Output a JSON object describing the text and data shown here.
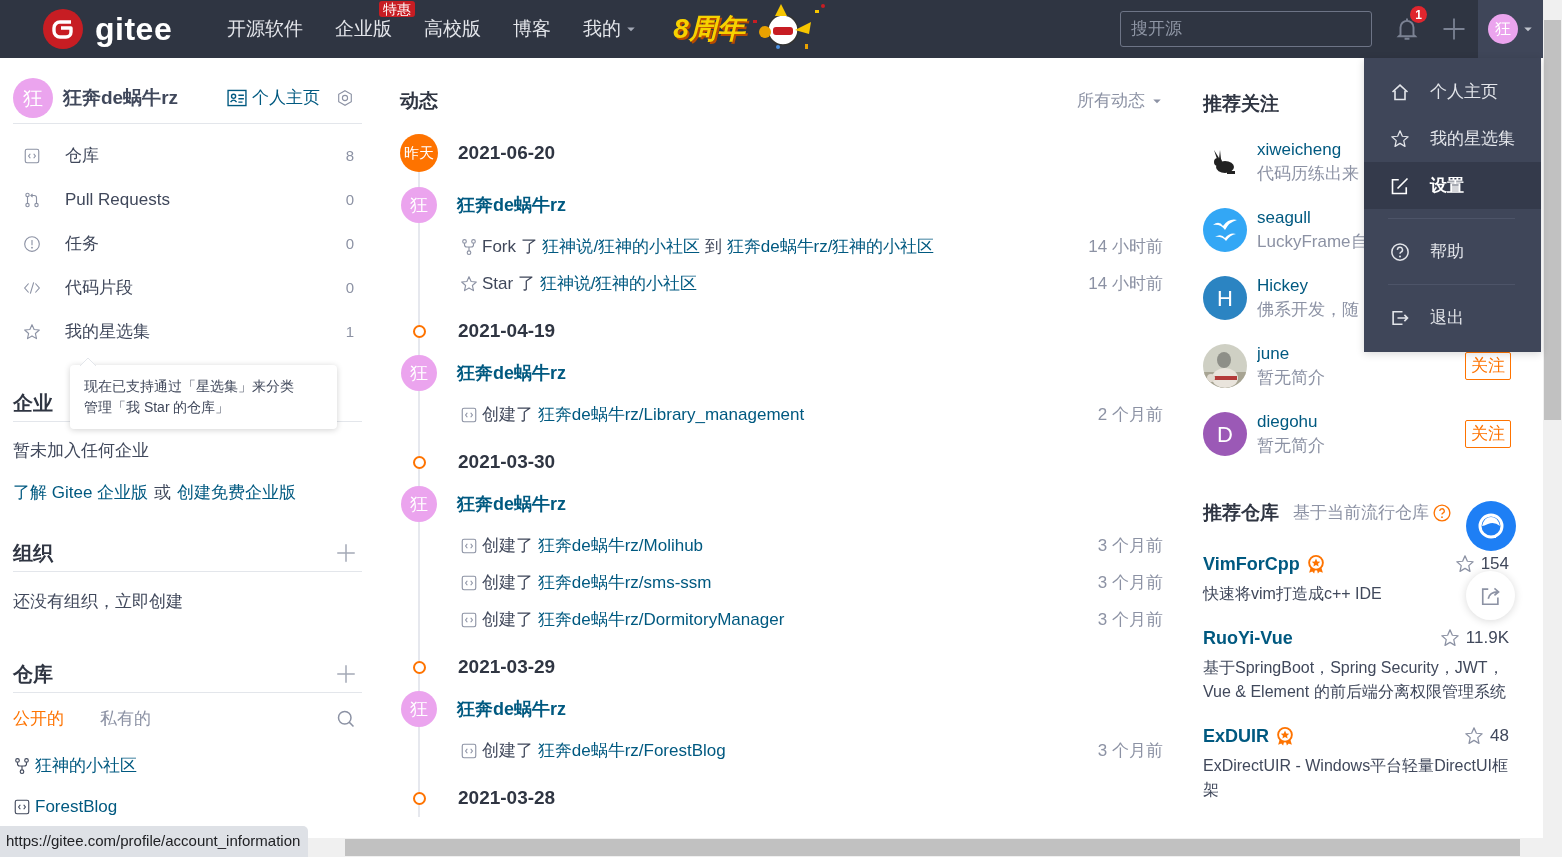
{
  "navbar": {
    "logo": "gitee",
    "links": [
      {
        "label": "开源软件"
      },
      {
        "label": "企业版",
        "badge": "特惠"
      },
      {
        "label": "高校版"
      },
      {
        "label": "博客"
      },
      {
        "label": "我的",
        "has_menu": true
      }
    ],
    "anniversary": "8周年",
    "search": {
      "placeholder": "搜开源"
    },
    "notification_count": "1",
    "avatar": "狂",
    "menu_open": true
  },
  "user_menu": [
    {
      "kind": "home",
      "label": "个人主页",
      "selected": false,
      "divider_before": false
    },
    {
      "kind": "star",
      "label": "我的星选集",
      "selected": false,
      "divider_before": false
    },
    {
      "kind": "edit",
      "label": "设置",
      "selected": true,
      "divider_before": false
    },
    {
      "kind": "help",
      "label": "帮助",
      "selected": false,
      "divider_before": true
    },
    {
      "kind": "logout",
      "label": "退出",
      "selected": false,
      "divider_before": true
    }
  ],
  "profile": {
    "avatar": "狂",
    "name": "狂奔de蜗牛rz",
    "homepage": "个人主页"
  },
  "sidebar": {
    "items": [
      {
        "kind": "repo",
        "label": "仓库",
        "count": "8"
      },
      {
        "kind": "pull",
        "label": "Pull Requests",
        "count": "0"
      },
      {
        "kind": "issue",
        "label": "任务",
        "count": "0"
      },
      {
        "kind": "code",
        "label": "代码片段",
        "count": "0"
      },
      {
        "kind": "star",
        "label": "我的星选集",
        "count": "1"
      }
    ]
  },
  "tooltip": "现在已支持通过「星选集」来分类管理「我 Star 的仓库」",
  "enterprise": {
    "title": "企业",
    "empty": "暂未加入任何企业",
    "parts": [
      {
        "text": "了解 Gitee 企业版",
        "link": true
      },
      {
        "text": "或",
        "link": false
      },
      {
        "text": "创建免费企业版",
        "link": true
      }
    ]
  },
  "organizations": {
    "title": "组织",
    "empty": "还没有组织，立即创建"
  },
  "repositories": {
    "title": "仓库",
    "tabs": [
      {
        "label": "公开的",
        "selected": true
      },
      {
        "label": "私有的",
        "selected": false
      }
    ],
    "items": [
      {
        "kind": "fork",
        "name": "狂神的小社区"
      },
      {
        "kind": "repo",
        "name": "ForestBlog"
      }
    ]
  },
  "feed": {
    "title": "动态",
    "filter": "所有动态",
    "groups": [
      {
        "date": "2021-06-20",
        "marker": "昨天",
        "user": {
          "avatar": "狂",
          "name": "狂奔de蜗牛rz"
        },
        "events": [
          {
            "kind": "fork",
            "parts": [
              {
                "text": "Fork 了",
                "link": false
              },
              {
                "text": "狂神说/狂神的小社区",
                "link": true
              },
              {
                "text": "到",
                "link": false
              },
              {
                "text": "狂奔de蜗牛rz/狂神的小社区",
                "link": true
              }
            ],
            "time": "14 小时前"
          },
          {
            "kind": "star",
            "parts": [
              {
                "text": "Star 了",
                "link": false
              },
              {
                "text": "狂神说/狂神的小社区",
                "link": true
              }
            ],
            "time": "14 小时前"
          }
        ]
      },
      {
        "date": "2021-04-19",
        "user": {
          "avatar": "狂",
          "name": "狂奔de蜗牛rz"
        },
        "events": [
          {
            "kind": "repo",
            "parts": [
              {
                "text": "创建了",
                "link": false
              },
              {
                "text": "狂奔de蜗牛rz/Library_management",
                "link": true
              }
            ],
            "time": "2 个月前"
          }
        ]
      },
      {
        "date": "2021-03-30",
        "user": {
          "avatar": "狂",
          "name": "狂奔de蜗牛rz"
        },
        "events": [
          {
            "kind": "repo",
            "parts": [
              {
                "text": "创建了",
                "link": false
              },
              {
                "text": "狂奔de蜗牛rz/Molihub",
                "link": true
              }
            ],
            "time": "3 个月前"
          },
          {
            "kind": "repo",
            "parts": [
              {
                "text": "创建了",
                "link": false
              },
              {
                "text": "狂奔de蜗牛rz/sms-ssm",
                "link": true
              }
            ],
            "time": "3 个月前"
          },
          {
            "kind": "repo",
            "parts": [
              {
                "text": "创建了",
                "link": false
              },
              {
                "text": "狂奔de蜗牛rz/DormitoryManager",
                "link": true
              }
            ],
            "time": "3 个月前"
          }
        ]
      },
      {
        "date": "2021-03-29",
        "user": {
          "avatar": "狂",
          "name": "狂奔de蜗牛rz"
        },
        "events": [
          {
            "kind": "repo",
            "parts": [
              {
                "text": "创建了",
                "link": false
              },
              {
                "text": "狂奔de蜗牛rz/ForestBlog",
                "link": true
              }
            ],
            "time": "3 个月前"
          }
        ]
      },
      {
        "date": "2021-03-28"
      }
    ]
  },
  "recommended_users": {
    "title": "推荐关注",
    "users": [
      {
        "kind": "rabbit",
        "name": "xiweicheng",
        "bio": "代码历练出来"
      },
      {
        "kind": "bird",
        "name": "seagull",
        "bio": "LuckyFrame自"
      },
      {
        "kind": "letter",
        "initial": "H",
        "color": "#2b84c2",
        "name": "Hickey",
        "bio": "佛系开发，随"
      },
      {
        "kind": "picture",
        "name": "june",
        "bio": "暂无简介",
        "follow": "关注"
      },
      {
        "kind": "letter",
        "initial": "D",
        "color": "#9b59b6",
        "name": "diegohu",
        "bio": "暂无简介",
        "follow": "关注"
      }
    ]
  },
  "recommended_repos": {
    "title": "推荐仓库",
    "subtitle": "基于当前流行仓库",
    "items": [
      {
        "name": "VimForCpp",
        "featured": true,
        "star_count": "154",
        "description": "快速将vim打造成c++ IDE"
      },
      {
        "name": "RuoYi-Vue",
        "featured": false,
        "star_count": "11.9K",
        "description": "基于SpringBoot，Spring Security，JWT，Vue & Element 的前后端分离权限管理系统"
      },
      {
        "name": "ExDUIR",
        "featured": true,
        "star_count": "48",
        "description": "ExDirectUIR - Windows平台轻量DirectUI框架"
      }
    ]
  },
  "status_url": "https://gitee.com/profile/account_information"
}
